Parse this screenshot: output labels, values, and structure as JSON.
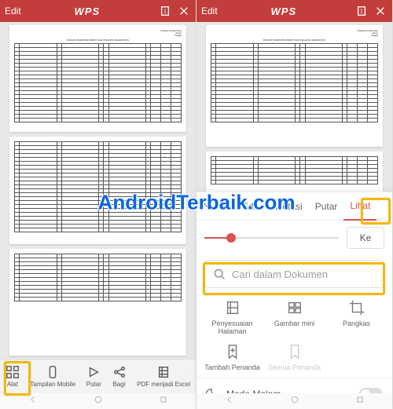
{
  "header": {
    "edit": "Edit",
    "logo": "WPS"
  },
  "watermark": "AndroidTerbaik.com",
  "left_toolbar": {
    "alat": "Alat",
    "tampilan": "Tampilan Mobile",
    "putar": "Putar",
    "bagi": "Bagi",
    "excel": "PDF menjadi Excel"
  },
  "sheet": {
    "tabs": {
      "s": "s",
      "edit": "Edit",
      "anotasi": "Anotasi",
      "putar": "Putar",
      "lihat": "Lihat"
    },
    "ke": "Ke",
    "search_placeholder": "Cari dalam Dokumen",
    "grid": {
      "penyesuaian": "Penyesuaian Halaman",
      "gambar": "Gambar mini",
      "pangkas": "Pangkas",
      "tambah": "Tambah Penanda",
      "semua": "Semua Penanda"
    },
    "mode": "Mode Malam"
  }
}
